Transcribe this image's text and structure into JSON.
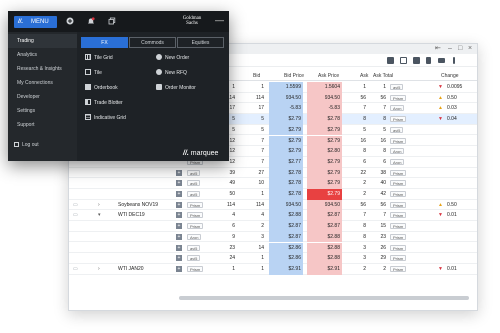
{
  "menu": {
    "button_label": "MENU",
    "brand": "Goldman Sachs",
    "sidebar_items": [
      "Trading",
      "Analytics",
      "Research & Insights",
      "My Connections",
      "Developer",
      "Settings",
      "Support"
    ],
    "logout_label": "Log out",
    "tabs": [
      "FX",
      "Commods",
      "Equities"
    ],
    "options_left": [
      "Tile Grid",
      "Tile",
      "Orderbook",
      "Trade Blotter",
      "Indicative Grid"
    ],
    "options_right": [
      "New Order",
      "New RFQ",
      "Order Monitor"
    ],
    "footer_brand": "marquee"
  },
  "grid": {
    "columns": [
      "bal",
      "Bid",
      "Bid Price",
      "Ask Price",
      "Ask",
      "Ask Total",
      "Change"
    ],
    "rows": [
      {
        "name": "",
        "expand": "",
        "sq": false,
        "cnt": "1",
        "bid": "1",
        "bid_price": "1.5599",
        "ask_price": "1.5604",
        "ask": "1",
        "ask_total": "1",
        "tag": "avi5",
        "dir": "down",
        "change": "0.0095",
        "hl": false
      },
      {
        "name": "",
        "expand": "",
        "sq": false,
        "cnt": "114",
        "bid": "114",
        "bid_price": "934.50",
        "ask_price": "934.50",
        "ask": "56",
        "ask_total": "56",
        "tag": "Prism",
        "dir": "up",
        "change": "0.50",
        "hl": false
      },
      {
        "name": "",
        "expand": "",
        "sq": false,
        "cnt": "17",
        "bid": "17",
        "bid_price": "-5.83",
        "ask_price": "-5.83",
        "ask": "7",
        "ask_total": "7",
        "tag": "Aron",
        "dir": "up",
        "change": "0.03",
        "hl": false
      },
      {
        "name": "",
        "expand": "",
        "sq": false,
        "cnt": "5",
        "bid": "5",
        "bid_price": "$2.79",
        "ask_price": "$2.78",
        "ask": "8",
        "ask_total": "8",
        "tag": "Prism",
        "dir": "down",
        "change": "0.04",
        "hl": true
      },
      {
        "name": "",
        "expand": "",
        "sq": false,
        "cnt": "5",
        "bid": "5",
        "bid_price": "$2.79",
        "ask_price": "$2.79",
        "ask": "5",
        "ask_total": "5",
        "tag": "avi5",
        "dir": "",
        "change": "",
        "hl": false
      },
      {
        "name": "",
        "expand": "",
        "sq": false,
        "cnt": "12",
        "bid": "7",
        "bid_price": "$2.79",
        "ask_price": "$2.79",
        "ask": "16",
        "ask_total": "16",
        "tag": "Prism",
        "dir": "",
        "change": "",
        "hl": false
      },
      {
        "name": "",
        "expand": "",
        "sq": false,
        "src": "avi5",
        "cnt": "12",
        "bid": "7",
        "bid_price": "$2.79",
        "ask_price": "$2.80",
        "ask": "8",
        "ask_total": "8",
        "tag": "Aron",
        "dir": "",
        "change": "",
        "hl": false
      },
      {
        "name": "",
        "expand": "",
        "sq": false,
        "src": "Prism",
        "cnt": "12",
        "bid": "7",
        "bid_price": "$2.77",
        "ask_price": "$2.79",
        "ask": "6",
        "ask_total": "6",
        "tag": "Aron",
        "dir": "",
        "change": "",
        "hl": false
      },
      {
        "name": "",
        "expand": "",
        "sq": true,
        "src": "avi5",
        "cnt": "39",
        "bid": "27",
        "bid_price": "$2.78",
        "ask_price": "$2.79",
        "ask": "22",
        "ask_total": "38",
        "tag": "Prism",
        "dir": "",
        "change": "",
        "hl": false
      },
      {
        "name": "",
        "expand": "",
        "sq": true,
        "src": "avi5",
        "cnt": "49",
        "bid": "10",
        "bid_price": "$2.78",
        "ask_price": "$2.79",
        "ask": "2",
        "ask_total": "40",
        "tag": "Prism",
        "dir": "",
        "change": "",
        "hl": false
      },
      {
        "name": "",
        "expand": "",
        "sq": true,
        "src": "avi5",
        "cnt": "50",
        "bid": "1",
        "bid_price": "$2.78",
        "ask_price": "$2.79",
        "ask": "2",
        "ask_total": "42",
        "tag": "Prism",
        "dir": "",
        "change": "",
        "hl": false,
        "hot": true
      },
      {
        "name": "Soybeans NOV19",
        "expand": ">",
        "sq": true,
        "src": "Prism",
        "cnt": "114",
        "bid": "114",
        "bid_price": "934.50",
        "ask_price": "934.50",
        "ask": "56",
        "ask_total": "56",
        "tag": "Prism",
        "dir": "up",
        "change": "0.50",
        "hl": false
      },
      {
        "name": "WTI DEC19",
        "expand": "v",
        "sq": true,
        "src": "Prism",
        "cnt": "4",
        "bid": "4",
        "bid_price": "$2.88",
        "ask_price": "$2.87",
        "ask": "7",
        "ask_total": "7",
        "tag": "Prism",
        "dir": "down",
        "change": "0.01",
        "hl": false
      },
      {
        "name": "",
        "expand": "",
        "sq": true,
        "src": "Prism",
        "cnt": "6",
        "bid": "2",
        "bid_price": "$2.87",
        "ask_price": "$2.87",
        "ask": "8",
        "ask_total": "15",
        "tag": "Prism",
        "dir": "",
        "change": "",
        "hl": false
      },
      {
        "name": "",
        "expand": "",
        "sq": true,
        "src": "Aron",
        "cnt": "9",
        "bid": "3",
        "bid_price": "$2.87",
        "ask_price": "$2.88",
        "ask": "8",
        "ask_total": "23",
        "tag": "Prism",
        "dir": "",
        "change": "",
        "hl": false
      },
      {
        "name": "",
        "expand": "",
        "sq": true,
        "src": "avi5",
        "cnt": "23",
        "bid": "14",
        "bid_price": "$2.86",
        "ask_price": "$2.88",
        "ask": "3",
        "ask_total": "26",
        "tag": "Prism",
        "dir": "",
        "change": "",
        "hl": false
      },
      {
        "name": "",
        "expand": "",
        "sq": true,
        "src": "avi5",
        "cnt": "24",
        "bid": "1",
        "bid_price": "$2.86",
        "ask_price": "$2.88",
        "ask": "3",
        "ask_total": "29",
        "tag": "Prism",
        "dir": "",
        "change": "",
        "hl": false
      },
      {
        "name": "WTI JAN20",
        "expand": ">",
        "sq": true,
        "src": "Prism",
        "cnt": "1",
        "bid": "1",
        "bid_price": "$2.91",
        "ask_price": "$2.91",
        "ask": "2",
        "ask_total": "2",
        "tag": "Prism",
        "dir": "down",
        "change": "0.01",
        "hl": false
      }
    ]
  },
  "colors": {
    "accent": "#2a6fd6",
    "bid": "#b9d3f3",
    "ask": "#f6c6c6",
    "ask_hot": "#e84141",
    "up": "#e8a317",
    "down": "#d93642"
  }
}
